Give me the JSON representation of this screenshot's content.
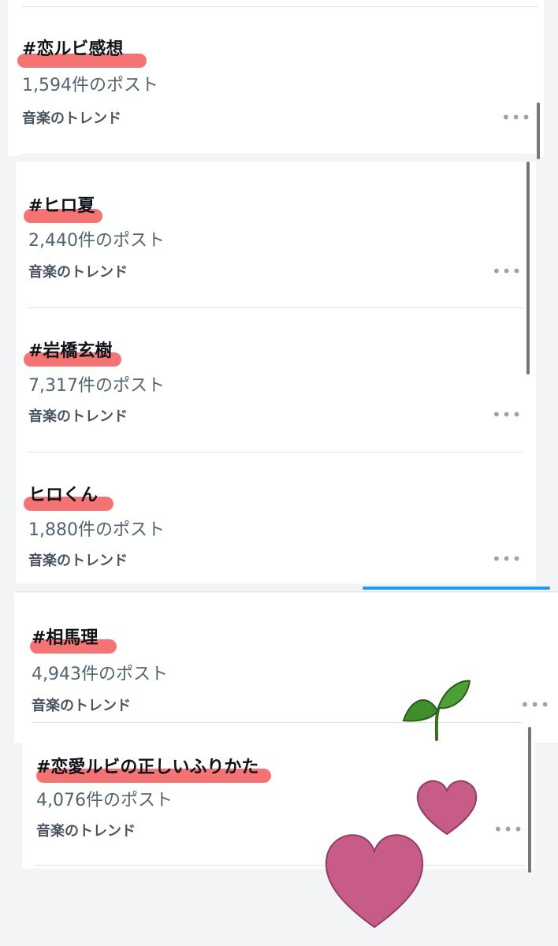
{
  "trends": [
    {
      "title": "#恋ルビ感想",
      "count": "1,594件のポスト",
      "category": "音楽のトレンド"
    },
    {
      "title": "#ヒロ夏",
      "count": "2,440件のポスト",
      "category": "音楽のトレンド"
    },
    {
      "title": "#岩橋玄樹",
      "count": "7,317件のポスト",
      "category": "音楽のトレンド"
    },
    {
      "title": "ヒロくん",
      "count": "1,880件のポスト",
      "category": "音楽のトレンド"
    },
    {
      "title": "#相馬理",
      "count": "4,943件のポスト",
      "category": "音楽のトレンド"
    },
    {
      "title": "#恋愛ルビの正しいふりかた",
      "count": "4,076件のポスト",
      "category": "音楽のトレンド"
    }
  ],
  "more_symbol": "•••",
  "icons": {
    "more": "more-horizontal-icon",
    "sprout": "sprout-sticker",
    "heart": "heart-sticker"
  },
  "colors": {
    "highlight": "#f25a5a",
    "accent": "#1d9bf0",
    "heart": "#c85c88",
    "sprout": "#3f8f2a"
  }
}
